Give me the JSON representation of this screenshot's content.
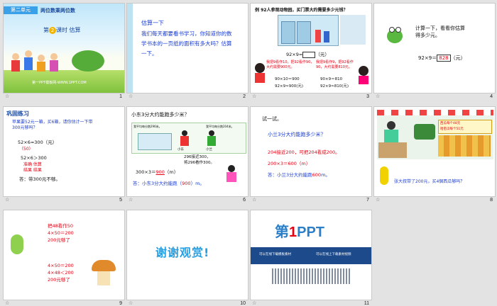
{
  "slides": [
    {
      "number": "1",
      "unit": "第二单元",
      "title": "两位数乘两位数",
      "lesson_pre": "第",
      "lesson_num": "2",
      "lesson_post": "课时 估算",
      "footer": "第一PPT模板网-WWW.1PPT.COM"
    },
    {
      "number": "2",
      "heading": "估算一下",
      "body": "我们每天都要看书学习，你知道你的数学书本的一页纸的面积有多大吗？估算一下。"
    },
    {
      "number": "3",
      "question": "例 92人参观动物园，买门票大约需要多少元钱？",
      "formula": "92×9=",
      "unit": "（元）",
      "speech_left": "我把9看作10，把92看作90，大约需要900元。",
      "speech_right": "我把9看作9，把92看作90，大约需要810元。",
      "calc_left1": "90×10＝900",
      "calc_left2": "92×9≈900(元)",
      "calc_right1": "90×9＝810",
      "calc_right2": "92×9≈810(元)"
    },
    {
      "number": "4",
      "prompt": "计算一下，看看你估算得多少元。",
      "formula": "92×9＝",
      "answer": "828",
      "unit": "（元）"
    },
    {
      "number": "5",
      "heading": "巩固练习",
      "question": "苹果要52元一箱，买6箱，请你估计一下带300元够吗？",
      "line1": "52×6≈300（元）",
      "line2": "（50）",
      "line3": "52×6＞300",
      "tags1": "准确  估算",
      "tags2": "结果  结果",
      "answer": "答：带300元不够。"
    },
    {
      "number": "6",
      "question": "小东3分大约能跑多少米？",
      "sign": "我平均每分跑296米。",
      "sign2": "我平均每分跑204米。",
      "name1": "小东",
      "name2": "小兰",
      "note1": "296接近300，",
      "note2": "将296看作300。",
      "calc": "300×3＝",
      "calc_ans": "900",
      "calc_unit": "（m）",
      "answer_pre": "答：小东3分大约能跑（",
      "answer_val": "900",
      "answer_post": "）m。"
    },
    {
      "number": "7",
      "heading": "试一试。",
      "question": "小兰3分大约能跑多少米？",
      "line1": "204接近200，可把204看成200。",
      "line2": "200×3＝600（m）",
      "answer_pre": "答：小兰3分大约能跑",
      "answer_val": "600",
      "answer_post": "m。"
    },
    {
      "number": "8",
      "sign1": "西瓜每个48元",
      "sign2": "哈密瓜每个51元",
      "bottom": "张大叔带了200元，买4個西瓜够吗？"
    },
    {
      "number": "9",
      "line1": "把48看作50",
      "line2": "4×50＝200",
      "line3": "200元够了",
      "line4": "4×50＝200",
      "line5": "4×48＜200",
      "line6": "200元够了"
    },
    {
      "number": "10",
      "thanks": "谢谢观赏!"
    },
    {
      "number": "11",
      "logo_pre": "第",
      "logo_num": "1",
      "logo_post": "PPT",
      "banner_left": "可以在线下载模板素材",
      "banner_right": "可以在线上下载素材视频"
    }
  ],
  "colors": {
    "red": "#e60012",
    "blue": "#1a3ccf",
    "sky": "#8fd3f4",
    "banner": "#1c4a8a"
  }
}
